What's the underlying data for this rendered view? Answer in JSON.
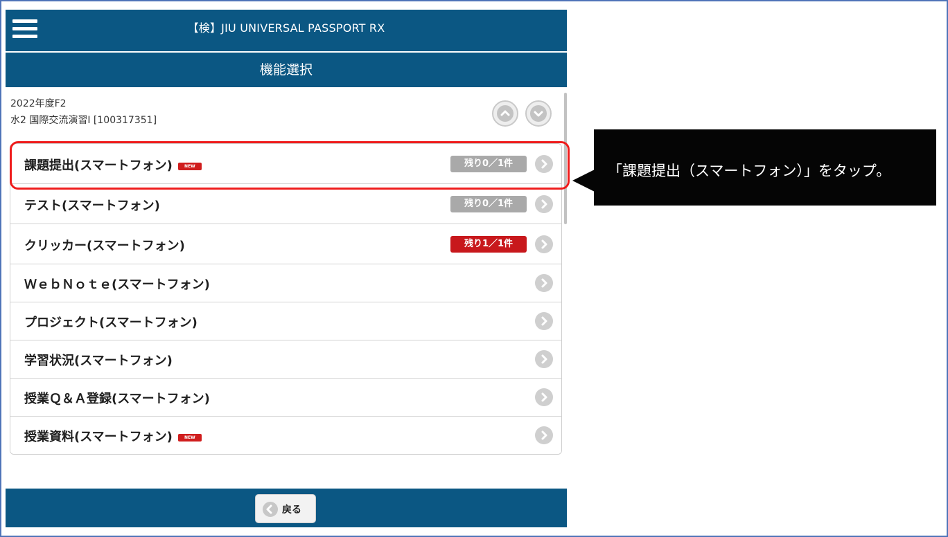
{
  "header": {
    "title": "【検】JIU UNIVERSAL PASSPORT RX",
    "menu_icon": "hamburger-icon"
  },
  "subheader": {
    "title": "機能選択"
  },
  "course": {
    "term": "2022年度F2",
    "name": "水2 国際交流演習I [100317351]"
  },
  "nav_buttons": {
    "up_icon": "chevron-up-icon",
    "down_icon": "chevron-down-icon"
  },
  "menu": {
    "items": [
      {
        "label": "課題提出(スマートフォン)",
        "new_badge": "NEW",
        "count": "残り0／1件",
        "count_color": "#a9a9a9"
      },
      {
        "label": "テスト(スマートフォン)",
        "count": "残り0／1件",
        "count_color": "#a9a9a9"
      },
      {
        "label": "クリッカー(スマートフォン)",
        "count": "残り1／1件",
        "count_color": "#c8181c"
      },
      {
        "label": "ＷｅｂＮｏｔｅ(スマートフォン)"
      },
      {
        "label": "プロジェクト(スマートフォン)"
      },
      {
        "label": "学習状況(スマートフォン)"
      },
      {
        "label": "授業Ｑ＆Ａ登録(スマートフォン)"
      },
      {
        "label": "授業資料(スマートフォン)",
        "new_badge": "NEW"
      }
    ]
  },
  "footer": {
    "back_label": "戻る"
  },
  "annotation": {
    "text": "「課題提出（スマートフォン）」をタップ。",
    "highlight_color": "#ef1c1c"
  },
  "colors": {
    "brand": "#0b5783",
    "callout_bg": "#050505"
  }
}
